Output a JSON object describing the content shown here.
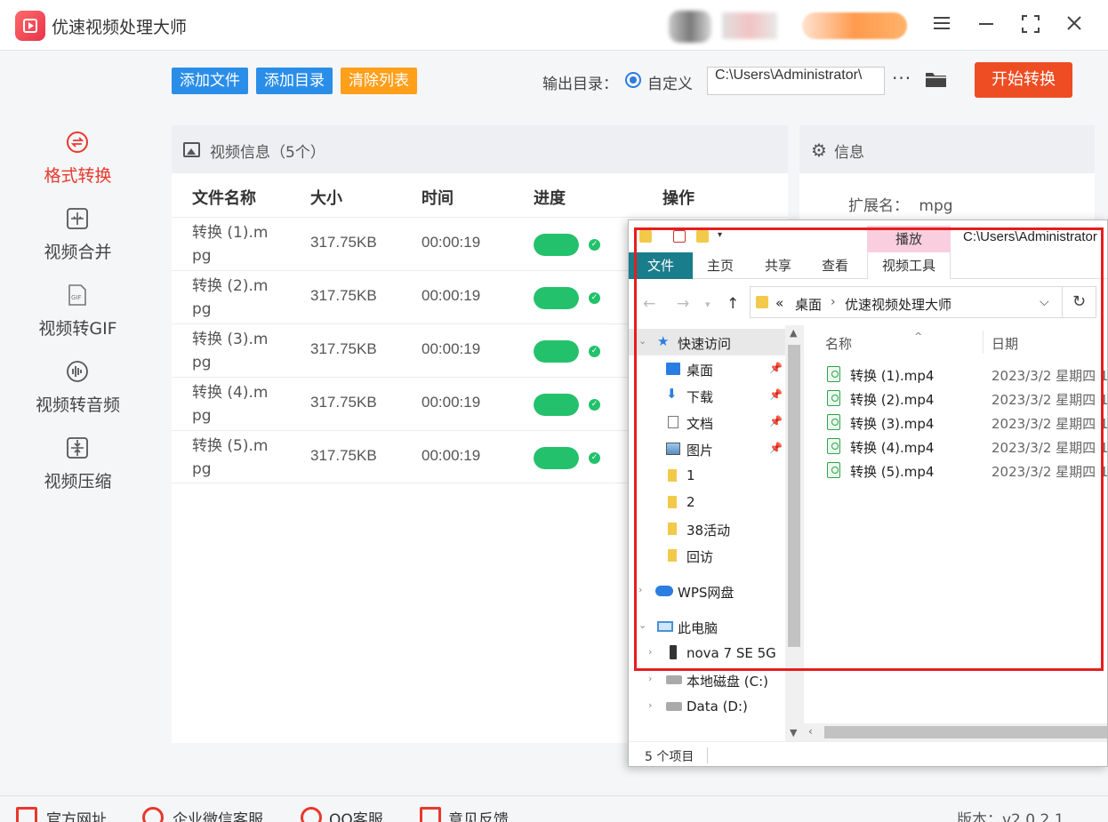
{
  "app": {
    "title": "优速视频处理大师",
    "window_buttons": [
      "menu-icon",
      "minimize-icon",
      "maximize-icon",
      "close-icon"
    ]
  },
  "sidebar": {
    "items": [
      {
        "label": "格式转换",
        "icon": "format-convert-icon",
        "active": true
      },
      {
        "label": "视频合并",
        "icon": "merge-icon",
        "active": false
      },
      {
        "label": "视频转GIF",
        "icon": "gif-icon",
        "active": false
      },
      {
        "label": "视频转音频",
        "icon": "audio-icon",
        "active": false
      },
      {
        "label": "视频压缩",
        "icon": "compress-icon",
        "active": false
      }
    ]
  },
  "toolbar": {
    "add_file": "添加文件",
    "add_dir": "添加目录",
    "clear_list": "清除列表",
    "output_label": "输出目录：",
    "output_option": "自定义",
    "output_path": "C:\\Users\\Administrator\\",
    "more": "···",
    "start": "开始转换"
  },
  "colors": {
    "accent_red": "#e8382c",
    "start_button": "#ee4d23",
    "blue_button": "#2a8ee8",
    "orange_button": "#ff9f1a",
    "progress_green": "#23c16b",
    "annotation_red": "#e61e1e",
    "explorer_file_tab": "#1a7d8c",
    "play_tab": "#f9cfe0"
  },
  "video_panel": {
    "title": "视频信息（5个）",
    "columns": [
      "文件名称",
      "大小",
      "时间",
      "进度",
      "操作"
    ],
    "rows": [
      {
        "name": "转换 (1).mpg",
        "size": "317.75KB",
        "time": "00:00:19",
        "progress": 1.0
      },
      {
        "name": "转换 (2).mpg",
        "size": "317.75KB",
        "time": "00:00:19",
        "progress": 1.0
      },
      {
        "name": "转换 (3).mpg",
        "size": "317.75KB",
        "time": "00:00:19",
        "progress": 1.0
      },
      {
        "name": "转换 (4).mpg",
        "size": "317.75KB",
        "time": "00:00:19",
        "progress": 1.0
      },
      {
        "name": "转换 (5).mpg",
        "size": "317.75KB",
        "time": "00:00:19",
        "progress": 1.0
      }
    ]
  },
  "info_panel": {
    "title": "信息",
    "ext_label": "扩展名：",
    "ext_value": "mpg"
  },
  "footer": {
    "items": [
      "官方网址",
      "企业微信客服",
      "QQ客服",
      "意见反馈"
    ],
    "version": "版本：v2.0.2.1"
  },
  "explorer": {
    "path_title": "C:\\Users\\Administrator",
    "play_tab": "播放",
    "ribbon_tabs": [
      "文件",
      "主页",
      "共享",
      "查看",
      "视频工具"
    ],
    "breadcrumb": [
      "«",
      "桌面",
      "优速视频处理大师"
    ],
    "tree": [
      {
        "label": "快速访问",
        "icon": "star-icon",
        "pinned": false,
        "expanded": true
      },
      {
        "label": "桌面",
        "icon": "desktop-icon",
        "pinned": true
      },
      {
        "label": "下载",
        "icon": "download-icon",
        "pinned": true
      },
      {
        "label": "文档",
        "icon": "document-icon",
        "pinned": true
      },
      {
        "label": "图片",
        "icon": "picture-icon",
        "pinned": true
      },
      {
        "label": "1",
        "icon": "folder-icon",
        "pinned": false
      },
      {
        "label": "2",
        "icon": "folder-icon",
        "pinned": false
      },
      {
        "label": "38活动",
        "icon": "folder-icon",
        "pinned": false
      },
      {
        "label": "回访",
        "icon": "folder-icon",
        "pinned": false
      },
      {
        "label": "WPS网盘",
        "icon": "cloud-icon",
        "pinned": false
      },
      {
        "label": "此电脑",
        "icon": "computer-icon",
        "pinned": false,
        "expanded": true
      },
      {
        "label": "nova 7 SE 5G",
        "icon": "phone-icon",
        "pinned": false
      },
      {
        "label": "本地磁盘 (C:)",
        "icon": "drive-icon",
        "pinned": false
      },
      {
        "label": "Data (D:)",
        "icon": "drive-icon",
        "pinned": false
      }
    ],
    "columns": [
      "名称",
      "日期"
    ],
    "files": [
      {
        "name": "转换 (1).mp4",
        "date": "2023/3/2 星期四 1"
      },
      {
        "name": "转换 (2).mp4",
        "date": "2023/3/2 星期四 1"
      },
      {
        "name": "转换 (3).mp4",
        "date": "2023/3/2 星期四 1"
      },
      {
        "name": "转换 (4).mp4",
        "date": "2023/3/2 星期四 1"
      },
      {
        "name": "转换 (5).mp4",
        "date": "2023/3/2 星期四 1"
      }
    ],
    "status": "5 个项目"
  }
}
